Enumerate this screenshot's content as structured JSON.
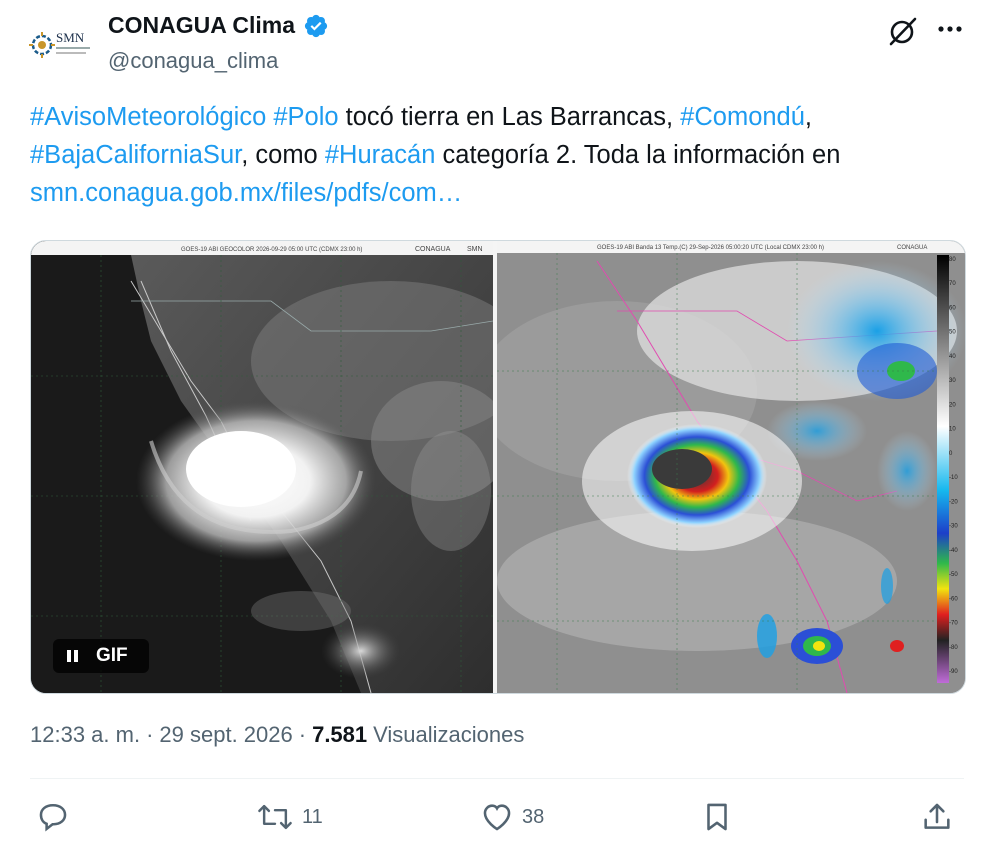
{
  "author": {
    "display_name": "CONAGUA Clima",
    "handle": "@conagua_clima",
    "avatar_text": "SMN",
    "verified": true
  },
  "tweet": {
    "segments": [
      {
        "text": "#AvisoMeteorológico",
        "link": true
      },
      {
        "text": " ",
        "link": false
      },
      {
        "text": "#Polo",
        "link": true
      },
      {
        "text": " tocó tierra en Las Barrancas, ",
        "link": false
      },
      {
        "text": "#Comondú",
        "link": true
      },
      {
        "text": ", ",
        "link": false
      },
      {
        "text": "#BajaCaliforniaSur",
        "link": true
      },
      {
        "text": ", como ",
        "link": false
      },
      {
        "text": "#Huracán",
        "link": true
      },
      {
        "text": " categoría 2. Toda la información en ",
        "link": false
      },
      {
        "text": "smn.conagua.gob.mx/files/pdfs/com…",
        "link": true
      }
    ]
  },
  "media": {
    "left_header": "GOES-19 ABI GEOCOLOR  2026-09-29 05:00 UTC (CDMX 23:00 h)",
    "right_header": "GOES-19 ABI Banda 13 Temp.(C) 29-Sep-2026 05:00:20 UTC (Local CDMX 23:00 h)",
    "logo_conagua": "CONAGUA",
    "logo_smn": "SMN",
    "gif_label": "GIF",
    "colorbar_ticks": [
      "80",
      "70",
      "60",
      "50",
      "40",
      "30",
      "20",
      "10",
      "0",
      "-10",
      "-20",
      "-30",
      "-40",
      "-50",
      "-60",
      "-70",
      "-80",
      "-90"
    ]
  },
  "meta": {
    "time": "12:33 a. m.",
    "separator": "·",
    "date": "29 sept. 2026",
    "views_count": "7.581",
    "views_label": "Visualizaciones"
  },
  "actions": {
    "reply_count": "",
    "retweet_count": "11",
    "like_count": "38"
  },
  "colors": {
    "link": "#1d9bf0",
    "text": "#0f1419",
    "secondary": "#536471",
    "verified": "#1d9bf0"
  }
}
